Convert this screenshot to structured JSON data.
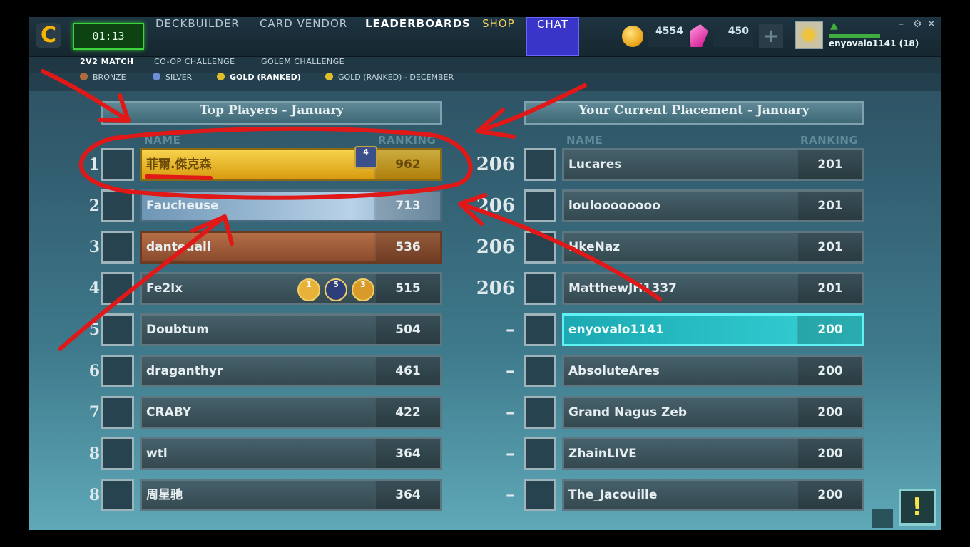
{
  "topbar": {
    "timer": "01:13",
    "nav": [
      "DECKBUILDER",
      "CARD VENDOR",
      "LEADERBOARDS",
      "SHOP",
      "CHAT"
    ],
    "coins": "4554",
    "gems": "450",
    "username": "enyovalo1141 (18)",
    "window_controls": [
      "–",
      "⚙",
      "✕"
    ]
  },
  "modes": [
    "2V2 MATCH",
    "CO-OP CHALLENGE",
    "GOLEM CHALLENGE"
  ],
  "leagues": [
    {
      "label": "BRONZE",
      "color": "#b06a3c"
    },
    {
      "label": "SILVER",
      "color": "#6e8fd6"
    },
    {
      "label": "GOLD (RANKED)",
      "color": "#e0be2a"
    },
    {
      "label": "GOLD (RANKED) - DECEMBER",
      "color": "#e0be2a"
    }
  ],
  "left_panel": {
    "title": "Top Players - January",
    "name_header": "NAME",
    "ranking_header": "RANKING",
    "rows": [
      {
        "rank": "1",
        "name": "菲爾.傑克森",
        "score": "962",
        "style": "gold",
        "badge": "4"
      },
      {
        "rank": "2",
        "name": "Faucheuse",
        "score": "713",
        "style": "silver"
      },
      {
        "rank": "3",
        "name": "dantedall",
        "score": "536",
        "style": "bronze"
      },
      {
        "rank": "4",
        "name": "Fe2lx",
        "score": "515",
        "style": "normal",
        "medals": [
          "1",
          "5",
          "3"
        ]
      },
      {
        "rank": "5",
        "name": "Doubtum",
        "score": "504",
        "style": "normal"
      },
      {
        "rank": "6",
        "name": "draganthyr",
        "score": "461",
        "style": "normal"
      },
      {
        "rank": "7",
        "name": "CRABY",
        "score": "422",
        "style": "normal"
      },
      {
        "rank": "8",
        "name": "wtl",
        "score": "364",
        "style": "normal"
      },
      {
        "rank": "8",
        "name": "周星驰",
        "score": "364",
        "style": "normal"
      }
    ]
  },
  "right_panel": {
    "title": "Your Current Placement - January",
    "name_header": "NAME",
    "ranking_header": "RANKING",
    "rows": [
      {
        "rank": "206",
        "name": "Lucares",
        "score": "201"
      },
      {
        "rank": "206",
        "name": "louloooooooo",
        "score": "201"
      },
      {
        "rank": "206",
        "name": "HkeNaz",
        "score": "201"
      },
      {
        "rank": "206",
        "name": "MatthewJH1337",
        "score": "201"
      },
      {
        "rank": "–",
        "name": "enyovalo1141",
        "score": "200",
        "me": true
      },
      {
        "rank": "–",
        "name": "AbsoluteAres",
        "score": "200"
      },
      {
        "rank": "–",
        "name": "Grand Nagus Zeb",
        "score": "200"
      },
      {
        "rank": "–",
        "name": "ZhainLIVE",
        "score": "200"
      },
      {
        "rank": "–",
        "name": "The_Jacouille",
        "score": "200"
      }
    ]
  },
  "help_button": "!"
}
